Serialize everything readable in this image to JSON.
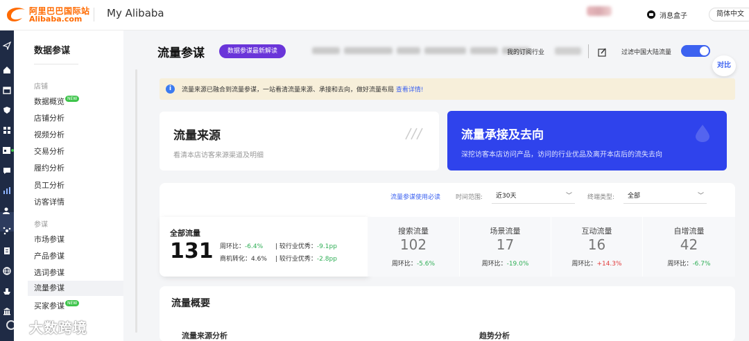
{
  "header": {
    "logo_line1": "阿里巴巴国际站",
    "logo_line2": "Alibaba.com",
    "app_title": "My Alibaba",
    "inbox_label": "消息盒子",
    "language": "简体中文"
  },
  "sidebar": {
    "title": "数据参谋",
    "groups": [
      {
        "label": "店铺",
        "items": [
          "数据概览",
          "店铺分析",
          "视频分析",
          "交易分析",
          "履约分析",
          "员工分析",
          "访客详情"
        ]
      },
      {
        "label": "参谋",
        "items": [
          "市场参谋",
          "产品参谋",
          "选词参谋",
          "流量参谋",
          "买家参谋"
        ]
      }
    ],
    "new_badge": "NEW"
  },
  "page": {
    "title": "流量参谋",
    "promo_label": "数据参谋最新解读",
    "industry_label": "我的订阅行业",
    "filter_label": "过滤中国大陆流量",
    "filter_on": true,
    "compare_label": "对比"
  },
  "notice": {
    "text": "流量来源已融合到流量参谋，一站看清流量来源、承接和去向，做好流量布局",
    "link": "查看详情!"
  },
  "cards": {
    "source_title": "流量来源",
    "source_desc": "看清本店访客来源渠道及明细",
    "flow_title": "流量承接及去向",
    "flow_desc": "深挖访客本店访问产品，访问的行业优品及离开本店后的流失去向"
  },
  "filters": {
    "help_link": "流量参谋使用必读",
    "time_label": "时间范围:",
    "time_value": "近30天",
    "terminal_label": "终端类型:",
    "terminal_value": "全部"
  },
  "total": {
    "label": "全部流量",
    "value": "131",
    "wow_label": "周环比：",
    "wow_value": "-6.4%",
    "industry_label": "较行业优秀：",
    "industry_value": "-9.1pp",
    "conv_label": "商机转化：",
    "conv_value": "4.6%",
    "conv_industry_label": "较行业优秀：",
    "conv_industry_value": "-2.8pp"
  },
  "stats": [
    {
      "label": "搜索流量",
      "value": "102",
      "change_label": "周环比：",
      "change": "-5.6%",
      "trend": "down"
    },
    {
      "label": "场景流量",
      "value": "17",
      "change_label": "周环比：",
      "change": "-19.0%",
      "trend": "down"
    },
    {
      "label": "互动流量",
      "value": "16",
      "change_label": "周环比：",
      "change": "+14.3%",
      "trend": "up"
    },
    {
      "label": "自增流量",
      "value": "42",
      "change_label": "周环比：",
      "change": "-6.7%",
      "trend": "down"
    }
  ],
  "overview": {
    "title": "流量概要",
    "source_analysis": "流量来源分析",
    "trend_analysis": "趋势分析"
  },
  "watermark": "大数跨境",
  "colors": {
    "accent": "#2f43ec",
    "brand": "#ff6a00",
    "promo": "#6a35d9",
    "positive": "#e23b3b",
    "negative": "#2eae55"
  }
}
